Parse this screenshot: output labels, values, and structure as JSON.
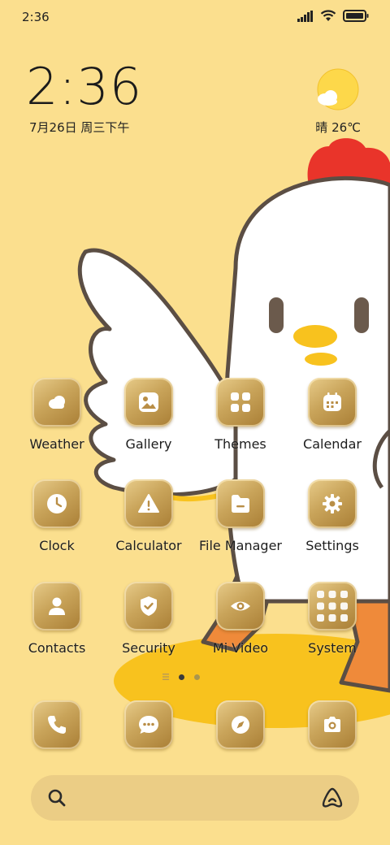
{
  "status_bar": {
    "time": "2:36"
  },
  "clock": {
    "time": "2:36",
    "date": "7月26日 周三下午"
  },
  "weather_widget": {
    "icon": "sun-cloud-icon",
    "text": "晴 26℃"
  },
  "apps": [
    {
      "label": "Weather",
      "icon": "weather-cloud-icon"
    },
    {
      "label": "Gallery",
      "icon": "gallery-image-icon"
    },
    {
      "label": "Themes",
      "icon": "themes-grid-icon"
    },
    {
      "label": "Calendar",
      "icon": "calendar-icon"
    },
    {
      "label": "Clock",
      "icon": "clock-icon"
    },
    {
      "label": "Calculator",
      "icon": "calculator-icon"
    },
    {
      "label": "File Manager",
      "icon": "folder-icon"
    },
    {
      "label": "Settings",
      "icon": "gear-icon"
    },
    {
      "label": "Contacts",
      "icon": "contact-person-icon"
    },
    {
      "label": "Security",
      "icon": "shield-check-icon"
    },
    {
      "label": "Mi Video",
      "icon": "eye-icon"
    },
    {
      "label": "System",
      "icon": "folder-grid-icon"
    }
  ],
  "dock": [
    {
      "icon": "phone-icon"
    },
    {
      "icon": "messages-icon"
    },
    {
      "icon": "compass-icon"
    },
    {
      "icon": "camera-icon"
    }
  ],
  "page_indicator": {
    "current": 2,
    "total": 3
  },
  "colors": {
    "wallpaper": "#fbdf8e",
    "icon_gold": "#c9a45a",
    "search_bar": "#ebcd85"
  }
}
